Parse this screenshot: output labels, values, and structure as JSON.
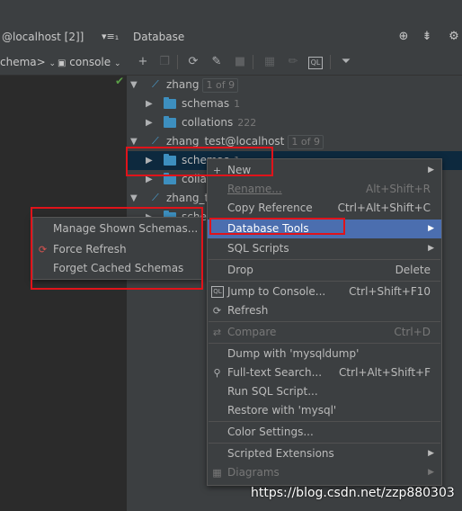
{
  "left": {
    "tab_label": "@localhost [2]]",
    "more_label": "▾≡₁",
    "schema_label": "chema>",
    "console_label": "console"
  },
  "db_panel": {
    "title": "Database",
    "icons": [
      "crosshair-icon",
      "collapse-icon",
      "gear-icon"
    ]
  },
  "toolbar": {
    "icons": [
      "add-icon",
      "copy-icon",
      "refresh-icon",
      "edit-properties-icon",
      "stop-icon",
      "table-icon",
      "edit-icon",
      "sql-console-icon",
      "filter-icon"
    ]
  },
  "tree": {
    "zhang": {
      "name": "zhang",
      "badge": "1 of 9"
    },
    "zhang_schemas": {
      "name": "schemas",
      "count": "1"
    },
    "zhang_collations": {
      "name": "collations",
      "count": "222"
    },
    "zhang_test": {
      "name": "zhang_test@localhost",
      "badge": "1 of 9"
    },
    "zt_schemas": {
      "name": "schemas",
      "count": "1"
    },
    "zt_collations": {
      "name": "colla"
    },
    "zhang_t": {
      "name": "zhang_t"
    },
    "zt2_schemas": {
      "name": "sche"
    }
  },
  "context_menu": {
    "items": [
      {
        "label": "New",
        "shortcut": "",
        "submenu": true
      },
      {
        "label": "Rename...",
        "shortcut": "Alt+Shift+R",
        "disabled": true
      },
      {
        "label": "Copy Reference",
        "shortcut": "Ctrl+Alt+Shift+C"
      },
      {
        "label": "Database Tools",
        "shortcut": "",
        "submenu": true,
        "highlighted": true
      },
      {
        "label": "SQL Scripts",
        "shortcut": "",
        "submenu": true
      },
      {
        "label": "Drop",
        "shortcut": "Delete"
      },
      {
        "label": "Jump to Console...",
        "shortcut": "Ctrl+Shift+F10"
      },
      {
        "label": "Refresh",
        "shortcut": ""
      },
      {
        "label": "Compare",
        "shortcut": "Ctrl+D",
        "disabled": true
      },
      {
        "label": "Dump with 'mysqldump'",
        "shortcut": ""
      },
      {
        "label": "Full-text Search...",
        "shortcut": "Ctrl+Alt+Shift+F"
      },
      {
        "label": "Run SQL Script...",
        "shortcut": ""
      },
      {
        "label": "Restore with 'mysql'",
        "shortcut": ""
      },
      {
        "label": "Color Settings...",
        "shortcut": ""
      },
      {
        "label": "Scripted Extensions",
        "shortcut": "",
        "submenu": true
      },
      {
        "label": "Diagrams",
        "shortcut": "",
        "submenu": true,
        "disabled": true
      }
    ]
  },
  "submenu": {
    "items": [
      {
        "label": "Manage Shown Schemas..."
      },
      {
        "label": "Force Refresh"
      },
      {
        "label": "Forget Cached Schemas"
      }
    ]
  },
  "watermark": "https://blog.csdn.net/zzp880303",
  "colors": {
    "highlight": "#4b6eaf",
    "annotation_red": "#e0131a",
    "folder": "#3d8fbf",
    "selection": "#0d293e"
  }
}
